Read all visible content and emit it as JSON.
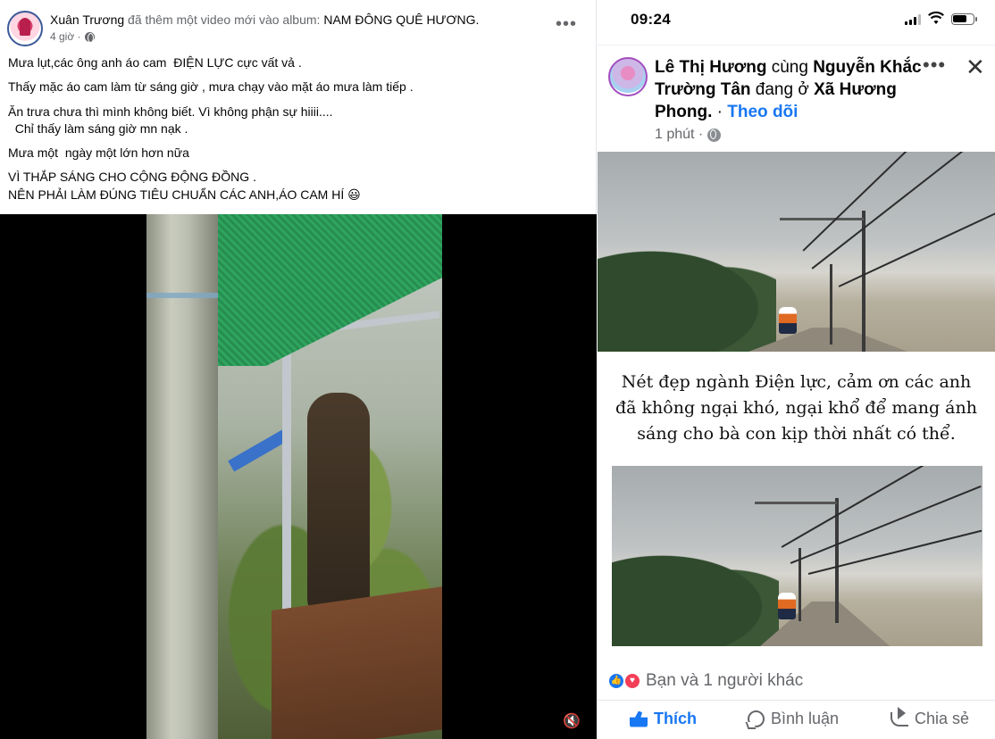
{
  "left_post": {
    "author": "Xuân Trương",
    "action_text": " đã thêm một video mới vào album: ",
    "album": "NAM ĐÔNG QUÊ HƯƠNG.",
    "time": "4 giờ ·",
    "more": "•••",
    "lines": [
      "Mưa lụt,các ông anh áo cam  ĐIỆN LỰC cực vất vả .",
      "Thấy mặc áo cam làm từ sáng giờ , mưa chạy vào mặt áo mưa làm tiếp .",
      "Ăn trưa chưa thì mình không biết. Vì không phận sự hiiii....",
      "  Chỉ thấy làm sáng giờ mn nạk .",
      "Mưa một  ngày một lớn hơn nữa",
      "VÌ THẮP SÁNG CHO CỘNG ĐỘNG ĐỒNG .",
      "NÊN PHẢI LÀM ĐÚNG TIÊU CHUẨN CÁC ANH,ÁO CAM HÍ 😃"
    ],
    "mute_icon": "🔇"
  },
  "phone": {
    "status_time": "09:24",
    "author": "Lê Thị Hương",
    "with_word": " cùng ",
    "tagged": "Nguyễn Khắc Trường Tân",
    "at_word": " đang ở ",
    "place": "Xã Hương Phong.",
    "dot": " · ",
    "follow": "Theo dõi",
    "time": "1 phút ·",
    "more": "•••",
    "close": "✕",
    "caption": "Nét đẹp ngành Điện lực, cảm ơn các anh đã không ngại khó, ngại khổ để mang ánh sáng cho bà con kịp thời nhất có thể.",
    "reactions_text": "Bạn và 1 người khác",
    "actions": {
      "like": "Thích",
      "comment": "Bình luận",
      "share": "Chia sẻ"
    }
  },
  "colors": {
    "fb_blue": "#1877f2",
    "meta_gray": "#65676b",
    "love_red": "#f33e58"
  }
}
